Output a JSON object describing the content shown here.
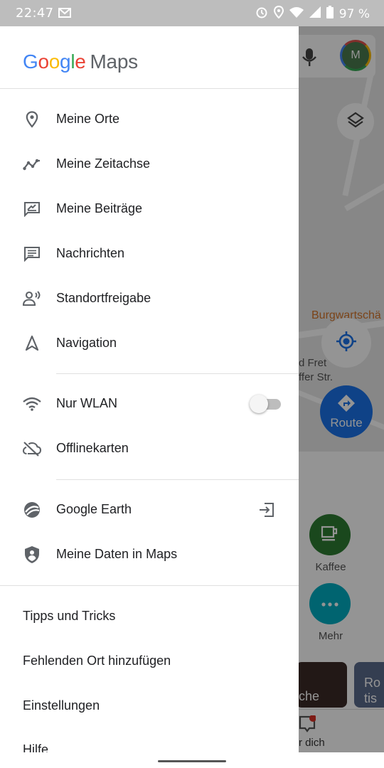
{
  "status_bar": {
    "time": "22:47",
    "battery": "97 %",
    "icons": [
      "gmail-icon",
      "alarm-icon",
      "location-icon",
      "wifi-icon",
      "signal-icon",
      "battery-icon"
    ]
  },
  "drawer": {
    "logo": {
      "google": "Google",
      "maps": "Maps",
      "colors": [
        "#4285f4",
        "#ea4335",
        "#fbbc05",
        "#4285f4",
        "#34a853",
        "#ea4335"
      ]
    },
    "menu_items": [
      {
        "label": "Meine Orte",
        "icon": "place-pin-icon"
      },
      {
        "label": "Meine Zeitachse",
        "icon": "timeline-icon"
      },
      {
        "label": "Meine Beiträge",
        "icon": "contributions-icon"
      },
      {
        "label": "Nachrichten",
        "icon": "messages-icon"
      },
      {
        "label": "Standortfreigabe",
        "icon": "location-sharing-icon"
      },
      {
        "label": "Navigation",
        "icon": "navigation-arrow-icon"
      }
    ],
    "wifi_only": {
      "label": "Nur WLAN",
      "icon": "wifi-icon",
      "enabled": false
    },
    "offline_maps": {
      "label": "Offlinekarten",
      "icon": "cloud-off-icon"
    },
    "google_earth": {
      "label": "Google Earth",
      "icon": "earth-icon",
      "action_icon": "open-external-icon"
    },
    "my_data": {
      "label": "Meine Daten in Maps",
      "icon": "shield-person-icon"
    },
    "footer_links": [
      "Tipps und Tricks",
      "Fehlenden Ort hinzufügen",
      "Einstellungen",
      "Hilfe"
    ]
  },
  "background_map": {
    "avatar_letter": "M",
    "poi_label": "Burgwartschä",
    "street_labels": [
      "d Fret",
      "ffer Str."
    ],
    "route_button": "Route",
    "categories": [
      {
        "label": "Kaffee",
        "color": "#2e7d32"
      },
      {
        "label": "Mehr",
        "color": "#00acc1"
      }
    ],
    "thumb_labels": [
      "che",
      "Ro",
      "tis"
    ],
    "bottom_tab": "r dich",
    "accent": "#1a73e8"
  }
}
